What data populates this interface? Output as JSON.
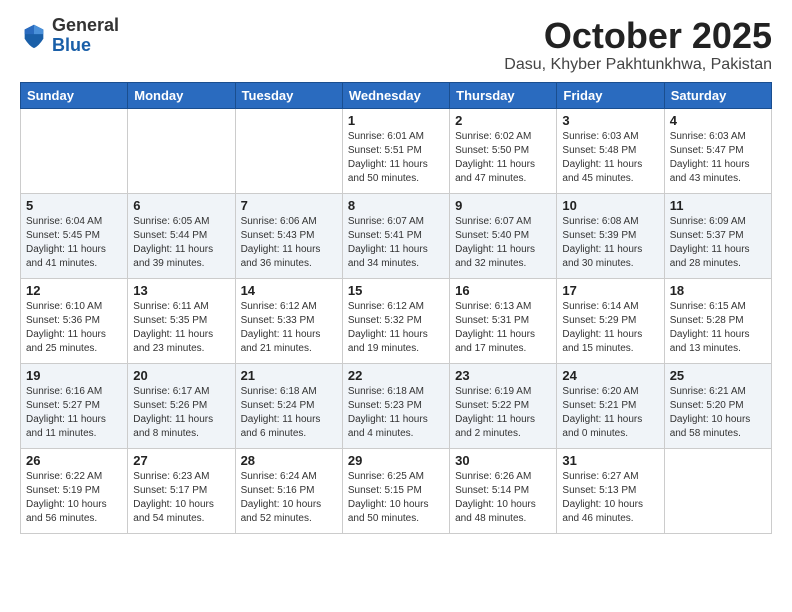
{
  "header": {
    "logo": {
      "general": "General",
      "blue": "Blue"
    },
    "title": "October 2025",
    "location": "Dasu, Khyber Pakhtunkhwa, Pakistan"
  },
  "weekdays": [
    "Sunday",
    "Monday",
    "Tuesday",
    "Wednesday",
    "Thursday",
    "Friday",
    "Saturday"
  ],
  "weeks": [
    [
      {
        "day": "",
        "info": ""
      },
      {
        "day": "",
        "info": ""
      },
      {
        "day": "",
        "info": ""
      },
      {
        "day": "1",
        "info": "Sunrise: 6:01 AM\nSunset: 5:51 PM\nDaylight: 11 hours\nand 50 minutes."
      },
      {
        "day": "2",
        "info": "Sunrise: 6:02 AM\nSunset: 5:50 PM\nDaylight: 11 hours\nand 47 minutes."
      },
      {
        "day": "3",
        "info": "Sunrise: 6:03 AM\nSunset: 5:48 PM\nDaylight: 11 hours\nand 45 minutes."
      },
      {
        "day": "4",
        "info": "Sunrise: 6:03 AM\nSunset: 5:47 PM\nDaylight: 11 hours\nand 43 minutes."
      }
    ],
    [
      {
        "day": "5",
        "info": "Sunrise: 6:04 AM\nSunset: 5:45 PM\nDaylight: 11 hours\nand 41 minutes."
      },
      {
        "day": "6",
        "info": "Sunrise: 6:05 AM\nSunset: 5:44 PM\nDaylight: 11 hours\nand 39 minutes."
      },
      {
        "day": "7",
        "info": "Sunrise: 6:06 AM\nSunset: 5:43 PM\nDaylight: 11 hours\nand 36 minutes."
      },
      {
        "day": "8",
        "info": "Sunrise: 6:07 AM\nSunset: 5:41 PM\nDaylight: 11 hours\nand 34 minutes."
      },
      {
        "day": "9",
        "info": "Sunrise: 6:07 AM\nSunset: 5:40 PM\nDaylight: 11 hours\nand 32 minutes."
      },
      {
        "day": "10",
        "info": "Sunrise: 6:08 AM\nSunset: 5:39 PM\nDaylight: 11 hours\nand 30 minutes."
      },
      {
        "day": "11",
        "info": "Sunrise: 6:09 AM\nSunset: 5:37 PM\nDaylight: 11 hours\nand 28 minutes."
      }
    ],
    [
      {
        "day": "12",
        "info": "Sunrise: 6:10 AM\nSunset: 5:36 PM\nDaylight: 11 hours\nand 25 minutes."
      },
      {
        "day": "13",
        "info": "Sunrise: 6:11 AM\nSunset: 5:35 PM\nDaylight: 11 hours\nand 23 minutes."
      },
      {
        "day": "14",
        "info": "Sunrise: 6:12 AM\nSunset: 5:33 PM\nDaylight: 11 hours\nand 21 minutes."
      },
      {
        "day": "15",
        "info": "Sunrise: 6:12 AM\nSunset: 5:32 PM\nDaylight: 11 hours\nand 19 minutes."
      },
      {
        "day": "16",
        "info": "Sunrise: 6:13 AM\nSunset: 5:31 PM\nDaylight: 11 hours\nand 17 minutes."
      },
      {
        "day": "17",
        "info": "Sunrise: 6:14 AM\nSunset: 5:29 PM\nDaylight: 11 hours\nand 15 minutes."
      },
      {
        "day": "18",
        "info": "Sunrise: 6:15 AM\nSunset: 5:28 PM\nDaylight: 11 hours\nand 13 minutes."
      }
    ],
    [
      {
        "day": "19",
        "info": "Sunrise: 6:16 AM\nSunset: 5:27 PM\nDaylight: 11 hours\nand 11 minutes."
      },
      {
        "day": "20",
        "info": "Sunrise: 6:17 AM\nSunset: 5:26 PM\nDaylight: 11 hours\nand 8 minutes."
      },
      {
        "day": "21",
        "info": "Sunrise: 6:18 AM\nSunset: 5:24 PM\nDaylight: 11 hours\nand 6 minutes."
      },
      {
        "day": "22",
        "info": "Sunrise: 6:18 AM\nSunset: 5:23 PM\nDaylight: 11 hours\nand 4 minutes."
      },
      {
        "day": "23",
        "info": "Sunrise: 6:19 AM\nSunset: 5:22 PM\nDaylight: 11 hours\nand 2 minutes."
      },
      {
        "day": "24",
        "info": "Sunrise: 6:20 AM\nSunset: 5:21 PM\nDaylight: 11 hours\nand 0 minutes."
      },
      {
        "day": "25",
        "info": "Sunrise: 6:21 AM\nSunset: 5:20 PM\nDaylight: 10 hours\nand 58 minutes."
      }
    ],
    [
      {
        "day": "26",
        "info": "Sunrise: 6:22 AM\nSunset: 5:19 PM\nDaylight: 10 hours\nand 56 minutes."
      },
      {
        "day": "27",
        "info": "Sunrise: 6:23 AM\nSunset: 5:17 PM\nDaylight: 10 hours\nand 54 minutes."
      },
      {
        "day": "28",
        "info": "Sunrise: 6:24 AM\nSunset: 5:16 PM\nDaylight: 10 hours\nand 52 minutes."
      },
      {
        "day": "29",
        "info": "Sunrise: 6:25 AM\nSunset: 5:15 PM\nDaylight: 10 hours\nand 50 minutes."
      },
      {
        "day": "30",
        "info": "Sunrise: 6:26 AM\nSunset: 5:14 PM\nDaylight: 10 hours\nand 48 minutes."
      },
      {
        "day": "31",
        "info": "Sunrise: 6:27 AM\nSunset: 5:13 PM\nDaylight: 10 hours\nand 46 minutes."
      },
      {
        "day": "",
        "info": ""
      }
    ]
  ]
}
